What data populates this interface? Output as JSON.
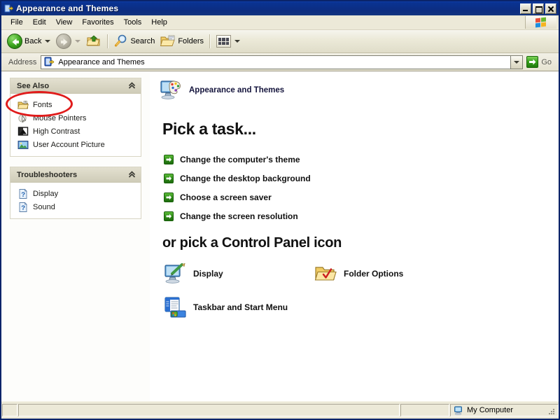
{
  "window": {
    "title": "Appearance and Themes",
    "title_icon": "control-panel-icon",
    "buttons": {
      "minimize": "Minimize",
      "maximize": "Maximize",
      "close": "Close"
    }
  },
  "menubar": {
    "items": [
      {
        "label": "File"
      },
      {
        "label": "Edit"
      },
      {
        "label": "View"
      },
      {
        "label": "Favorites"
      },
      {
        "label": "Tools"
      },
      {
        "label": "Help"
      }
    ],
    "brand_icon": "windows-flag-icon"
  },
  "toolbar": {
    "back_label": "Back",
    "back_icon": "back-arrow-icon",
    "forward_icon": "forward-arrow-icon",
    "up_icon": "up-folder-icon",
    "search_label": "Search",
    "search_icon": "magnifier-icon",
    "folders_label": "Folders",
    "folders_icon": "folders-icon",
    "views_icon": "views-grid-icon"
  },
  "address": {
    "label": "Address",
    "value": "Appearance and Themes",
    "icon": "control-panel-icon",
    "dropdown_icon": "chevron-down-icon",
    "go_label": "Go",
    "go_icon": "go-arrow-icon"
  },
  "sidebar": {
    "panels": [
      {
        "title": "See Also",
        "collapse_icon": "chevron-up-icon",
        "items": [
          {
            "label": "Fonts",
            "icon": "fonts-folder-icon",
            "highlighted": true
          },
          {
            "label": "Mouse Pointers",
            "icon": "mouse-pointer-icon"
          },
          {
            "label": "High Contrast",
            "icon": "high-contrast-icon"
          },
          {
            "label": "User Account Picture",
            "icon": "user-picture-icon"
          }
        ]
      },
      {
        "title": "Troubleshooters",
        "collapse_icon": "chevron-up-icon",
        "items": [
          {
            "label": "Display",
            "icon": "help-question-icon"
          },
          {
            "label": "Sound",
            "icon": "help-question-icon"
          }
        ]
      }
    ],
    "annotation": {
      "shape": "ellipse",
      "color": "#e01b1b",
      "targets": "Fonts"
    }
  },
  "main": {
    "category": {
      "label": "Appearance and Themes",
      "icon": "appearance-themes-icon"
    },
    "task_heading": "Pick a task...",
    "tasks": [
      {
        "label": "Change the computer's theme",
        "icon": "green-arrow-icon"
      },
      {
        "label": "Change the desktop background",
        "icon": "green-arrow-icon"
      },
      {
        "label": "Choose a screen saver",
        "icon": "green-arrow-icon"
      },
      {
        "label": "Change the screen resolution",
        "icon": "green-arrow-icon"
      }
    ],
    "icon_heading": "or pick a Control Panel icon",
    "cp_icons": [
      {
        "label": "Display",
        "icon": "display-icon"
      },
      {
        "label": "Folder Options",
        "icon": "folder-options-icon"
      },
      {
        "label": "Taskbar and Start Menu",
        "icon": "taskbar-start-menu-icon"
      }
    ]
  },
  "statusbar": {
    "left": "",
    "middle": "",
    "right": "My Computer",
    "right_icon": "my-computer-icon"
  },
  "colors": {
    "titlebar": "#0a3392",
    "accent_green": "#2f8c18",
    "annotation_red": "#e01b1b",
    "window_face": "#ece9d8"
  }
}
